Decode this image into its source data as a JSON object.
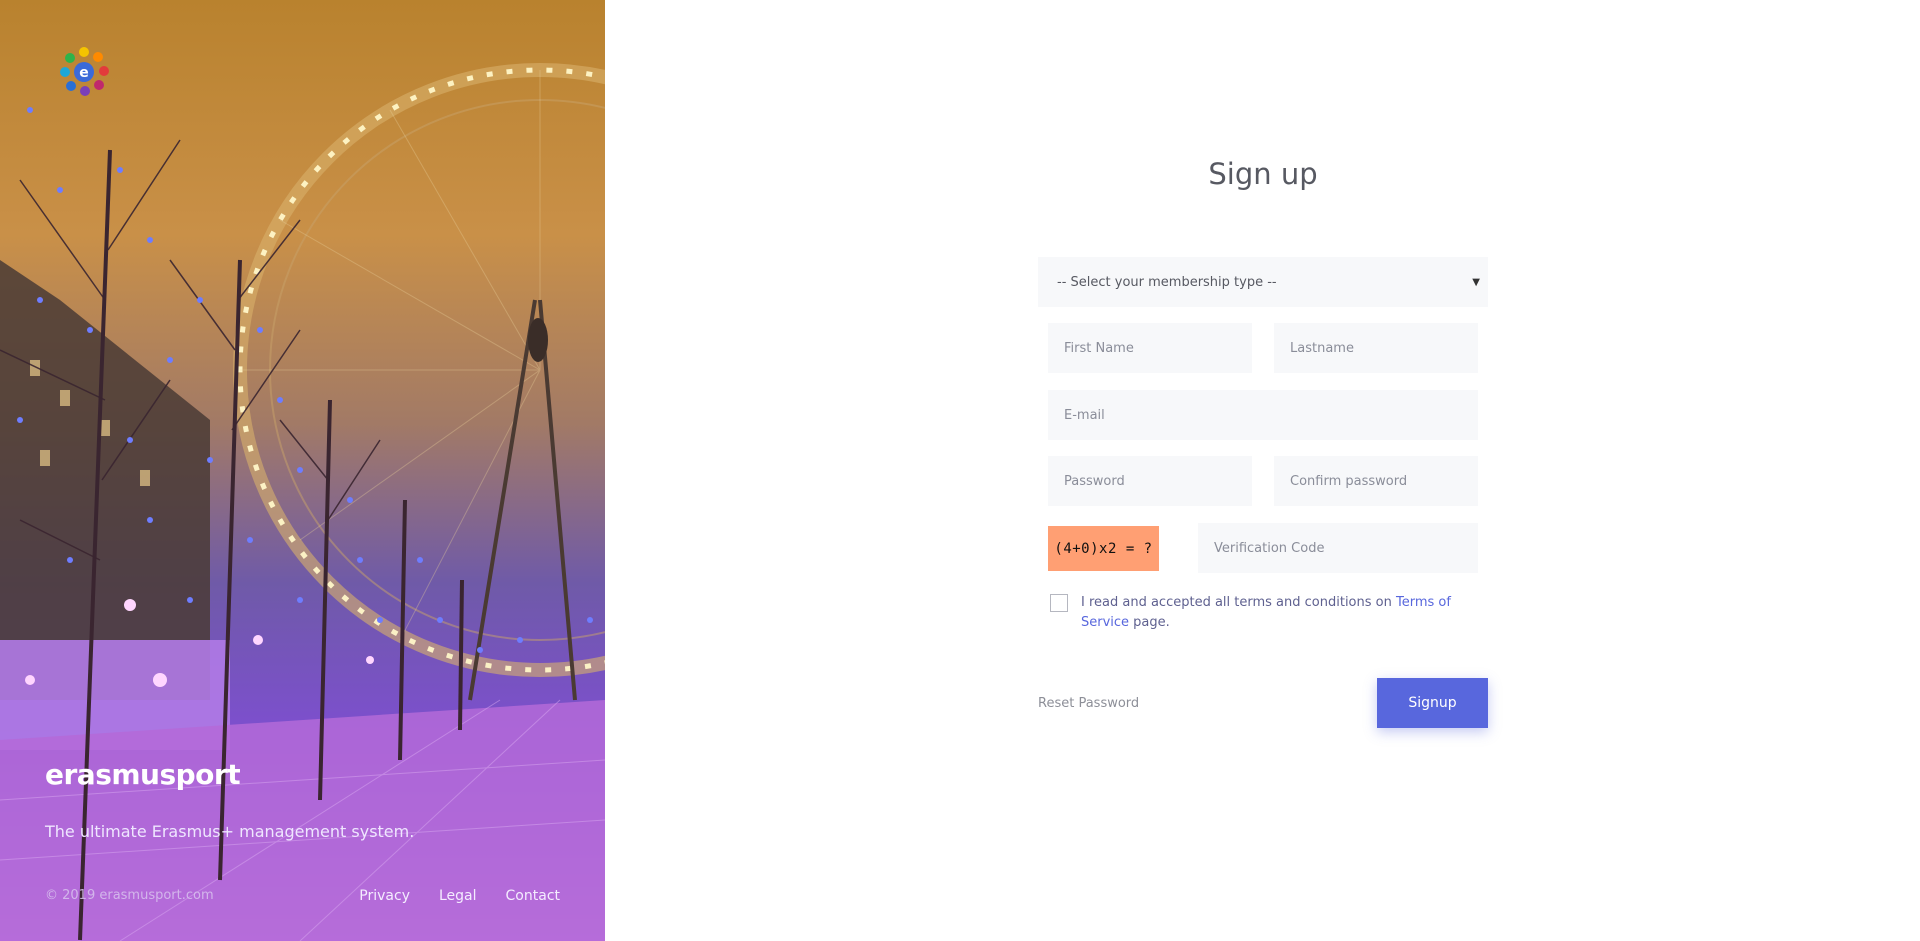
{
  "hero": {
    "brand": "erasmusport",
    "tagline": "The ultimate Erasmus+ management system.",
    "copyright": "© 2019 erasmusport.com",
    "links": [
      "Privacy",
      "Legal",
      "Contact"
    ]
  },
  "form": {
    "title": "Sign up",
    "membership_select": "-- Select your membership type --",
    "first_name_placeholder": "First Name",
    "last_name_placeholder": "Lastname",
    "email_placeholder": "E-mail",
    "password_placeholder": "Password",
    "confirm_password_placeholder": "Confirm password",
    "captcha": "(4+0)x2 = ?",
    "verification_placeholder": "Verification Code",
    "terms_text": "I read and accepted all terms and conditions on ",
    "terms_link": "Terms of Service",
    "terms_suffix": " page.",
    "reset_password": "Reset Password",
    "signup_button": "Signup"
  },
  "colors": {
    "accent": "#5867dd",
    "captcha_bg": "#ff9f73",
    "field_bg": "#f7f8fa"
  }
}
